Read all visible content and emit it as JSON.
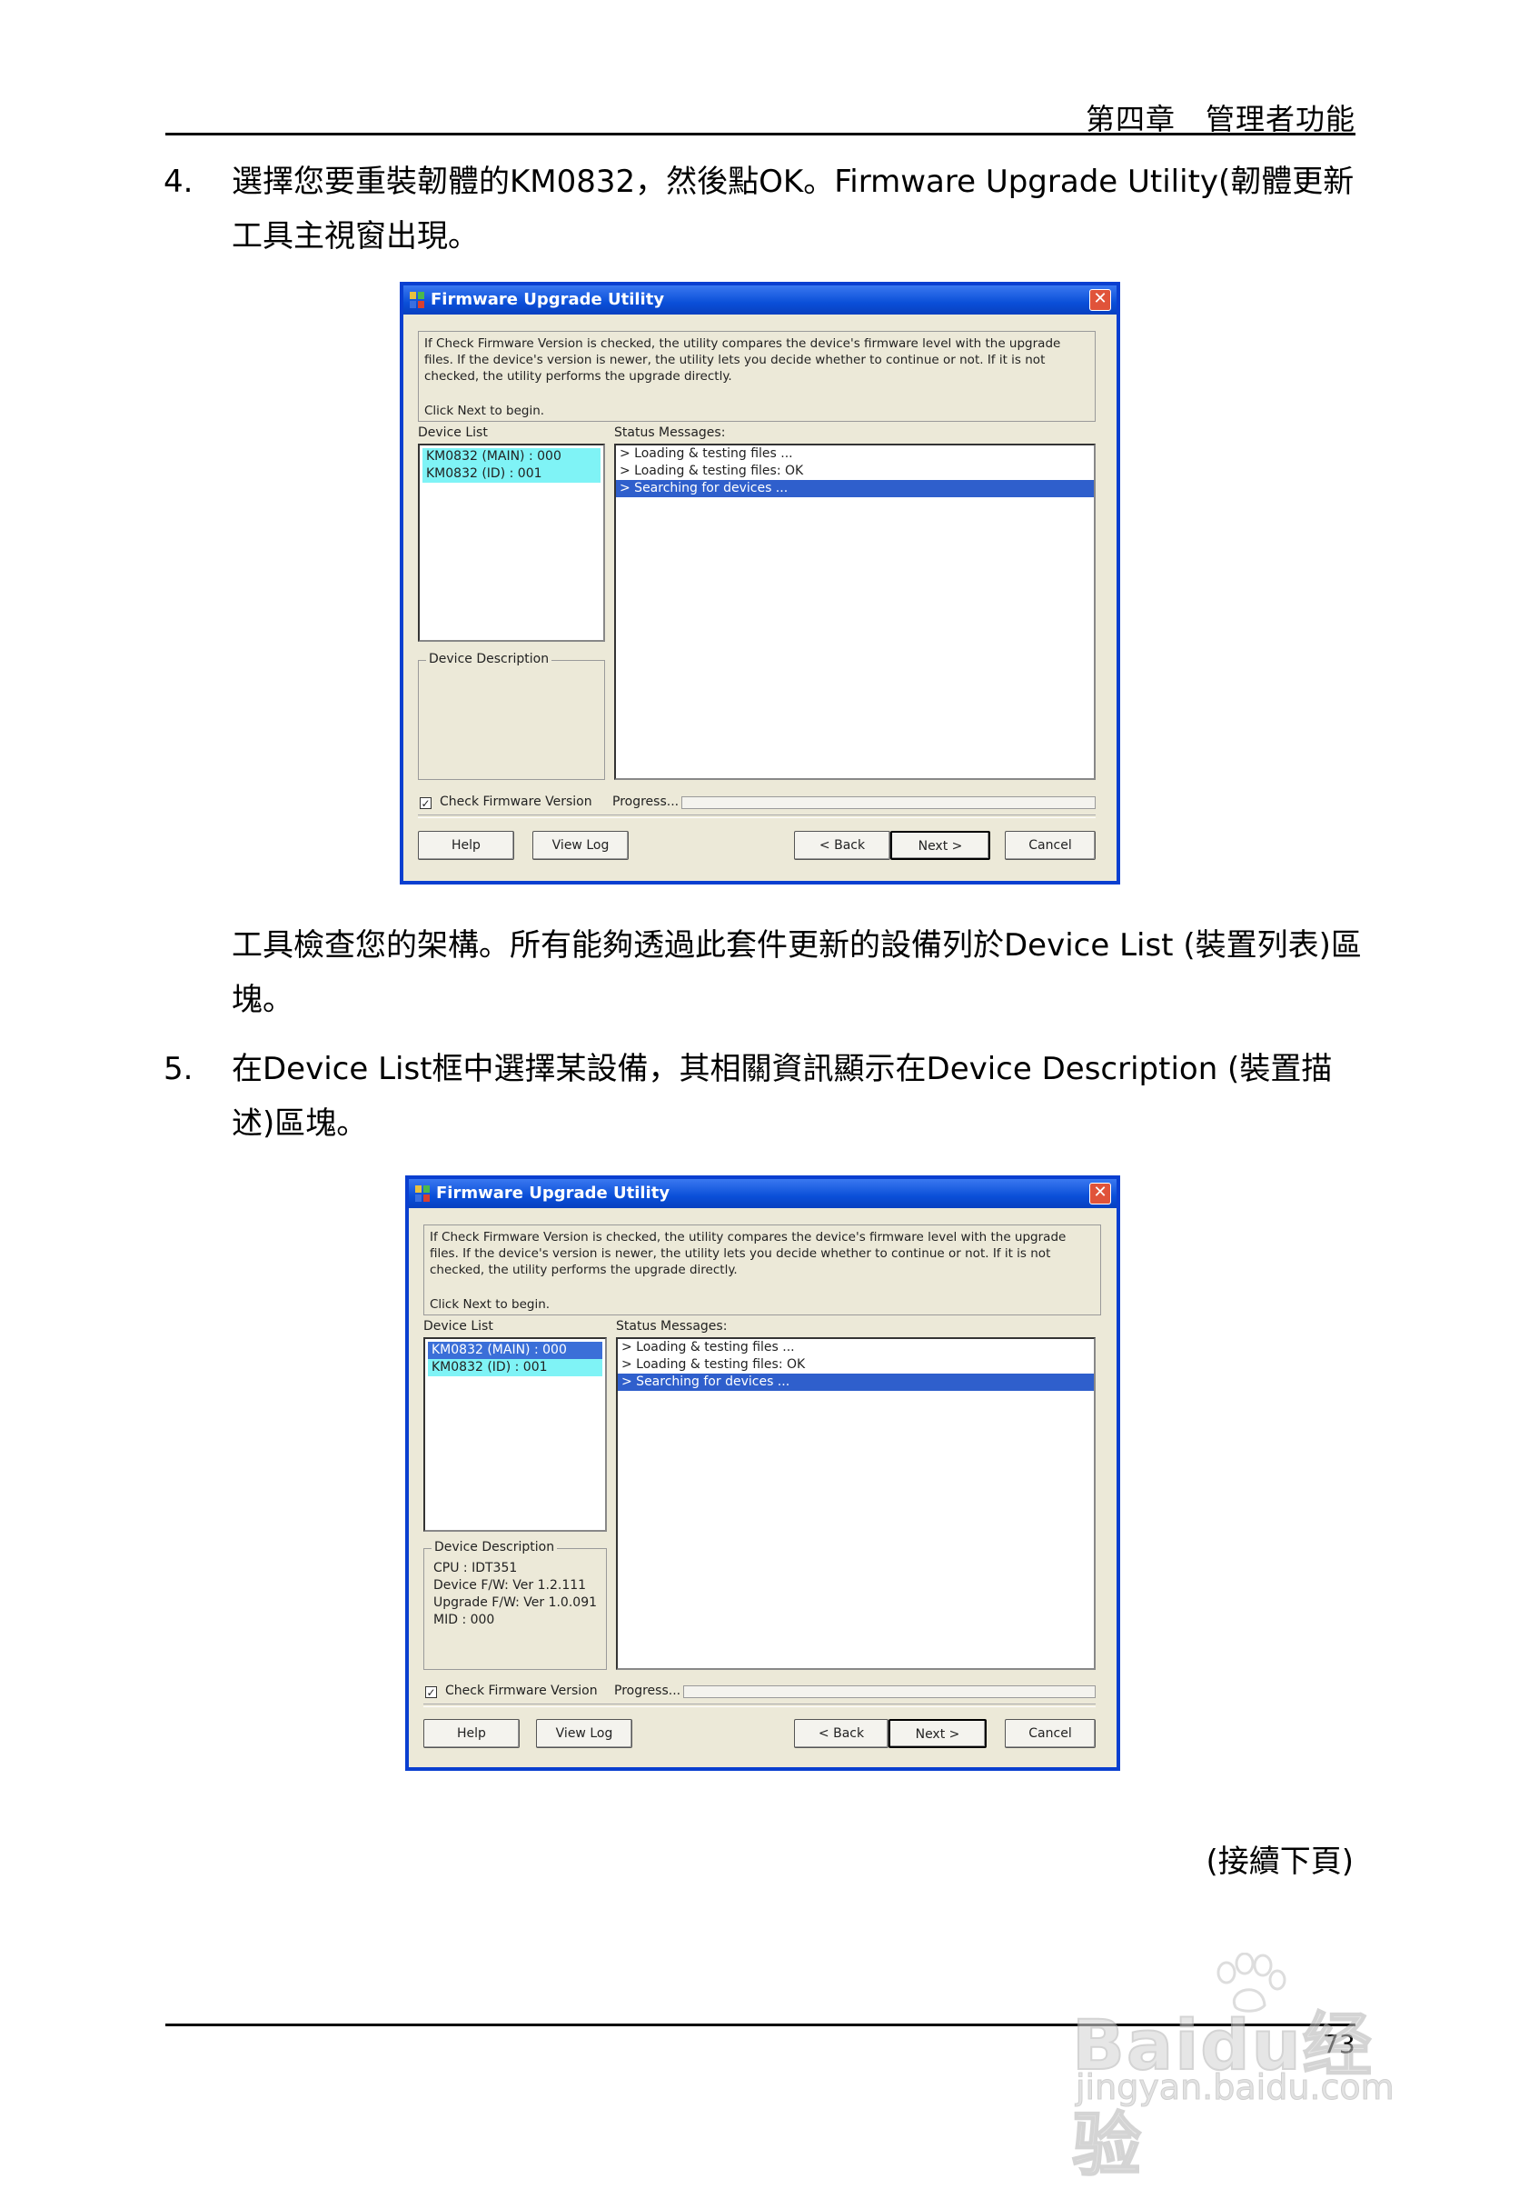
{
  "header": {
    "chapter": "第四章　管理者功能"
  },
  "steps": [
    {
      "number": "4.",
      "text": "選擇您要重裝韌體的KM0832，然後點OK。Firmware Upgrade Utility(韌體更新工具主視窗出現。"
    },
    {
      "number": "5.",
      "text": "在Device List框中選擇某設備，其相關資訊顯示在Device Description (裝置描述)區塊。"
    }
  ],
  "paragraph_after_1": "工具檢查您的架構。所有能夠透過此套件更新的設備列於Device List (裝置列表)區塊。",
  "continue_note": "(接續下頁)",
  "page_number": "73",
  "dialog": {
    "title": "Firmware Upgrade Utility",
    "info_text": "If Check Firmware Version is checked, the utility compares the device's firmware level with the upgrade files. If the device's version is newer, the utility lets you decide whether to continue or not. If it is not checked, the utility performs the upgrade directly.",
    "begin_text": "Click Next to begin.",
    "device_list_label": "Device List",
    "status_label": "Status Messages:",
    "devices": [
      "KM0832 (MAIN) : 000",
      "KM0832 (ID) : 001"
    ],
    "messages": [
      "> Loading & testing files ...",
      "> Loading & testing files: OK",
      "> Searching for devices ..."
    ],
    "device_description_label": "Device Description",
    "check_firmware_label": "Check Firmware Version",
    "progress_label": "Progress...",
    "buttons": {
      "help": "Help",
      "view_log": "View Log",
      "back": "< Back",
      "next": "Next >",
      "cancel": "Cancel"
    },
    "close_glyph": "✕",
    "check_glyph": "✓"
  },
  "dialog2_description": [
    "CPU : IDT351",
    "Device F/W: Ver 1.2.111",
    "Upgrade F/W: Ver 1.0.091",
    "MID : 000"
  ],
  "watermark": {
    "main": "Baidu经验",
    "sub": "jingyan.baidu.com"
  }
}
